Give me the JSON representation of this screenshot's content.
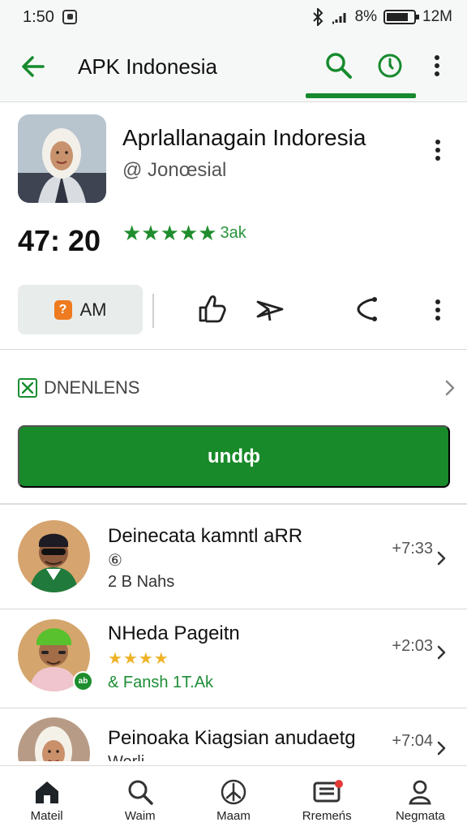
{
  "status_bar": {
    "time": "1:50",
    "battery_text": "8%",
    "right_text": "12M"
  },
  "app_bar": {
    "title": "APK Indonesia",
    "back_icon": "arrow-left-icon",
    "search_icon": "search-icon",
    "activity_icon": "clock-icon",
    "more_icon": "more-vertical-icon",
    "accent": "#168a2e"
  },
  "hero": {
    "title": "Aprlallanagain Indoresia",
    "subtitle": "@ Jonœsial",
    "rating_value": "47: 20",
    "stars": "★★★★★",
    "rating_count": "3ak"
  },
  "actions": {
    "chip_label": "AM",
    "chip_icon_text": "?"
  },
  "info": {
    "label": "DNENLENS"
  },
  "install": {
    "label": "undф"
  },
  "list": [
    {
      "title": "Deinecata kamntl aRR",
      "meta1": "⑥",
      "meta2": "2 B Nahs",
      "time": "+7:33"
    },
    {
      "title": "NHeda Pageitn",
      "stars": "★★★★",
      "meta2": "& Fansh 1T.Ak",
      "time": "+2:03",
      "badge": "ab"
    },
    {
      "title": "Peinoaka Kiagsian anudaetg",
      "meta2": "Werli",
      "time": "+7:04"
    }
  ],
  "bottom_nav": [
    {
      "label": "Mateil",
      "icon": "home-icon"
    },
    {
      "label": "Waim",
      "icon": "search-icon"
    },
    {
      "label": "Maam",
      "icon": "compass-icon"
    },
    {
      "label": "Rremeńs",
      "icon": "news-icon"
    },
    {
      "label": "Negmata",
      "icon": "profile-icon"
    }
  ]
}
